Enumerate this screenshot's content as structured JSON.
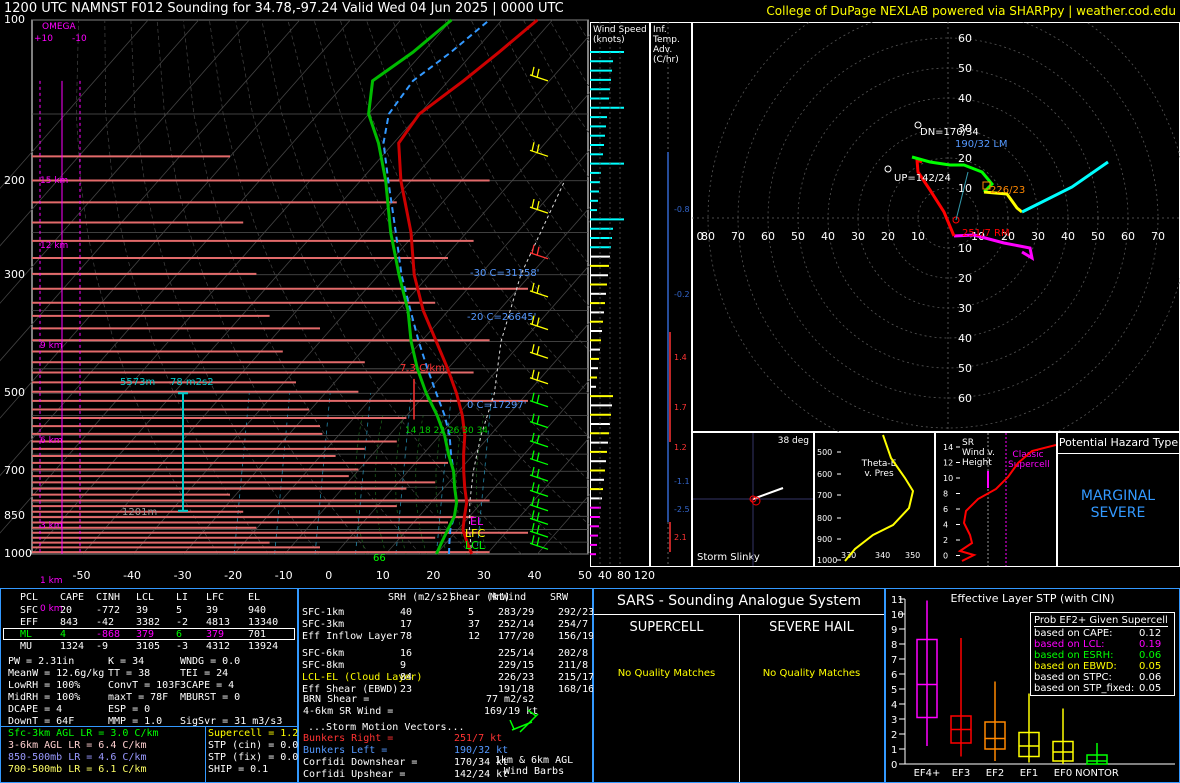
{
  "header": {
    "title": "1200 UTC NAMNST F012 Sounding for 34.78,-97.24 Valid  Wed 04 Jun 2025 | 0000 UTC",
    "credit": "College of DuPage NEXLAB powered via SHARPpy | weather.cod.edu"
  },
  "colors": {
    "temp": "#cc0000",
    "dew": "#00bb00",
    "wetbulb": "#00ffff",
    "parcel": "#f0f0f0",
    "virt": "#ff0000",
    "bg": "#000000",
    "accent_yellow": "#ffff00",
    "magenta": "#ff00ff",
    "cyan": "#00ffff",
    "blue": "#5599ff"
  },
  "skewt": {
    "p_ticks": [
      "100",
      "200",
      "300",
      "500",
      "700",
      "850",
      "1000"
    ],
    "t_ticks": [
      "-50",
      "-40",
      "-30",
      "-20",
      "-10",
      "0",
      "10",
      "20",
      "30",
      "40",
      "50"
    ],
    "omega_label": "OMEGA",
    "omega_ticks": [
      "+10",
      "-10"
    ],
    "height_labels": [
      "15 km",
      "12 km",
      "9 km",
      "6 km",
      "3 km",
      "1 km",
      "0 km"
    ],
    "annotations": {
      "hgz_top": "-30 C=31158'",
      "hgz_mid": "-20 C=26645'",
      "hgz_low": "0 C=17297'",
      "lapse": "7.3 C/km",
      "ebwd_top": "5573m",
      "ebwd_val": "78 m2s2",
      "ebwd_base": "1201m",
      "wbz": "66",
      "el": "EL",
      "lfc": "LFC",
      "lcl": "LCL",
      "dcape_ticks": "14 18 22 26 30 34"
    }
  },
  "chart_data": {
    "type": "line",
    "title": "1200 UTC NAMNST F012 Sounding for 34.78,-97.24 Valid  Wed 04 Jun 2025 | 0000 UTC",
    "xlabel": "",
    "ylabel": "",
    "ylim": [
      1000,
      100
    ],
    "xlim": [
      -50,
      50
    ],
    "series": [
      {
        "name": "",
        "p": [
          1000,
          950,
          900,
          850,
          800,
          750,
          700,
          650,
          600,
          550,
          500,
          450,
          400,
          350,
          300,
          250,
          200,
          170,
          150,
          130,
          115,
          100
        ],
        "values": [
          27,
          24,
          21,
          19,
          17,
          14,
          11,
          8,
          5,
          1,
          -4,
          -10,
          -17,
          -25,
          -33,
          -41,
          -52,
          -59,
          -60,
          -57,
          -55,
          -53
        ]
      },
      {
        "name": "",
        "p": [
          1000,
          950,
          900,
          850,
          800,
          750,
          700,
          650,
          600,
          550,
          500,
          450,
          400,
          350,
          300,
          250,
          200,
          170,
          150,
          130,
          115,
          100
        ],
        "values": [
          20,
          19,
          18,
          17,
          15,
          12,
          9,
          5,
          1,
          -4,
          -10,
          -16,
          -22,
          -28,
          -36,
          -45,
          -55,
          -63,
          -70,
          -75,
          -72,
          -70
        ]
      }
    ]
  },
  "wind_speed": {
    "label": "Wind Speed (knots)",
    "ticks": [
      "40",
      "80",
      "120"
    ]
  },
  "inf_temp": {
    "label": "Inf. Temp. Adv.(C/hr)",
    "values": [
      "-0.8",
      "-0.2",
      "1.4",
      "1.7",
      "1.2",
      "-1.1",
      "-2.5",
      "2.1"
    ]
  },
  "hodo": {
    "rings": [
      "10",
      "20",
      "30",
      "40",
      "50",
      "60",
      "70",
      "80"
    ],
    "labels": {
      "dn": "DN=170/34",
      "lm": "190/32 LM",
      "up": "UP=142/24",
      "rm": "251/7 RM",
      "mean": "226/23"
    }
  },
  "slinky": {
    "deg": "38 deg",
    "label": "Storm Slinky"
  },
  "thetae": {
    "title": "Theta-E v. Pres",
    "yticks": [
      "500",
      "600",
      "700",
      "800",
      "900",
      "1000"
    ],
    "xticks": [
      "330",
      "340",
      "350"
    ]
  },
  "srwind": {
    "title": "SR Wind v. Height",
    "note": "Classic Supercell",
    "yticks": [
      "14",
      "12",
      "10",
      "8",
      "6",
      "4",
      "2",
      "0"
    ]
  },
  "hazard": {
    "title": "Potential Hazard Type",
    "value": "MARGINAL SEVERE"
  },
  "parcels": {
    "headers": [
      "PCL",
      "CAPE",
      "CINH",
      "LCL",
      "LI",
      "LFC",
      "EL"
    ],
    "rows": [
      [
        "SFC",
        "20",
        "-772",
        "39",
        "5",
        "39",
        "940"
      ],
      [
        "EFF",
        "843",
        "-42",
        "3382",
        "-2",
        "4813",
        "13340"
      ],
      [
        "ML",
        "4",
        "-868",
        "379",
        "6",
        "379",
        "701"
      ],
      [
        "MU",
        "1324",
        "-9",
        "3105",
        "-3",
        "4312",
        "13924"
      ]
    ],
    "thermo": [
      [
        "PW = 2.31in",
        "K = 34",
        "WNDG = 0.0"
      ],
      [
        "MeanW = 12.6g/kg",
        "TT = 38",
        "TEI = 24"
      ],
      [
        "LowRH = 100%",
        "ConvT = 103F",
        "3CAPE = 4"
      ],
      [
        "MidRH = 100%",
        "maxT = 78F",
        "MBURST = 0"
      ],
      [
        "DCAPE = 4",
        "ESP = 0",
        ""
      ],
      [
        "DownT = 64F",
        "MMP = 1.0",
        "SigSvr = 31 m3/s3"
      ]
    ],
    "lapse": [
      "Sfc-3km AGL LR = 3.0 C/km",
      "3-6km AGL LR = 6.4 C/km",
      "850-500mb LR = 4.6 C/km",
      "700-500mb LR = 6.1 C/km"
    ],
    "indices": [
      "Supercell = 1.2",
      "STP (cin) = 0.0",
      "STP (fix) = 0.0",
      "SHIP = 0.1"
    ]
  },
  "kinematics": {
    "headers": [
      "SRH (m2/s2)",
      "Shear (kt)",
      "MnWind",
      "SRW"
    ],
    "rows": [
      [
        "SFC-1km",
        "40",
        "5",
        "283/29",
        "292/23"
      ],
      [
        "SFC-3km",
        "17",
        "37",
        "252/14",
        "254/7"
      ],
      [
        "Eff Inflow Layer",
        "78",
        "12",
        "177/20",
        "156/19"
      ],
      [
        "SFC-6km",
        "16",
        "",
        "225/14",
        "202/8"
      ],
      [
        "SFC-8km",
        "9",
        "",
        "229/15",
        "211/8"
      ],
      [
        "LCL-EL (Cloud Layer)",
        "84",
        "",
        "226/23",
        "215/17"
      ],
      [
        "Eff Shear (EBWD)",
        "23",
        "",
        "191/18",
        "168/16"
      ]
    ],
    "brn": [
      "BRN Shear =",
      "77 m2/s2"
    ],
    "sr4to6": [
      "4-6km SR Wind =",
      "169/19 kt"
    ],
    "vectors_title": "...Storm Motion Vectors...",
    "vectors": [
      [
        "Bunkers Right =",
        "251/7 kt"
      ],
      [
        "Bunkers Left =",
        "190/32 kt"
      ],
      [
        "Corfidi Downshear =",
        "170/34 kt"
      ],
      [
        "Corfidi Upshear =",
        "142/24 kt"
      ]
    ],
    "barbs_label": "1km & 6km AGL Wind Barbs"
  },
  "sars": {
    "title": "SARS - Sounding Analogue System",
    "supercell": "SUPERCELL",
    "hail": "SEVERE HAIL",
    "sc_match": "No Quality Matches",
    "hail_match": "No Quality Matches"
  },
  "stp": {
    "title": "Effective Layer STP (with CIN)",
    "yticks": [
      "11",
      "10",
      "9",
      "8",
      "7",
      "6",
      "5",
      "4",
      "3",
      "2",
      "1",
      "0"
    ],
    "cats": [
      "EF4+",
      "EF3",
      "EF2",
      "EF1",
      "EF0",
      "NONTOR"
    ],
    "box_colors": [
      "#ff00ff",
      "#ff0000",
      "#ff8800",
      "#ffff00",
      "#ffff00",
      "#00ff00"
    ],
    "boxes": [
      [
        1.2,
        3.1,
        5.3,
        8.3,
        10.9
      ],
      [
        0.5,
        1.4,
        2.3,
        3.2,
        8.4
      ],
      [
        0.2,
        1,
        1.7,
        2.8,
        5.5
      ],
      [
        0.1,
        0.5,
        1.2,
        2.1,
        4.7
      ],
      [
        0,
        0.2,
        0.8,
        1.5,
        3.7
      ],
      [
        0,
        0,
        0.2,
        0.6,
        1.4
      ]
    ],
    "prob_title": "Prob EF2+ Given Supercell",
    "probs": [
      [
        "based on CAPE:",
        "0.12",
        "#ffffff"
      ],
      [
        "based on LCL:",
        "0.19",
        "#ff00ff"
      ],
      [
        "based on ESRH:",
        "0.06",
        "#00ff00"
      ],
      [
        "based on EBWD:",
        "0.05",
        "#ffff00"
      ],
      [
        "based on STPC:",
        "0.06",
        "#ffffff"
      ],
      [
        "based on STP_fixed:",
        "0.05",
        "#ffffff"
      ]
    ]
  }
}
